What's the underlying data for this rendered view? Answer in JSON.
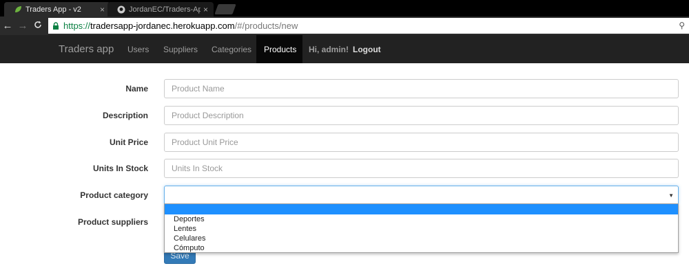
{
  "browser": {
    "tabs": [
      {
        "title": "Traders App - v2",
        "close": "×"
      },
      {
        "title": "JordanEC/Traders-App",
        "close": "×"
      }
    ],
    "nav": {
      "back": "←",
      "forward": "→",
      "reload": "C"
    },
    "url": {
      "scheme": "https://",
      "host": "tradersapp-jordanec.herokuapp.com",
      "path": "/#/products/new"
    },
    "key_glyph": "⚲"
  },
  "navbar": {
    "brand": "Traders app",
    "items": [
      "Users",
      "Suppliers",
      "Categories",
      "Products"
    ],
    "active": "Products",
    "greeting": "Hi, admin!",
    "logout": "Logout"
  },
  "form": {
    "name": {
      "label": "Name",
      "placeholder": "Product Name"
    },
    "description": {
      "label": "Description",
      "placeholder": "Product Description"
    },
    "unit_price": {
      "label": "Unit Price",
      "placeholder": "Product Unit Price"
    },
    "units_in_stock": {
      "label": "Units In Stock",
      "placeholder": "Units In Stock"
    },
    "category": {
      "label": "Product category",
      "value": "",
      "options": [
        "Deportes",
        "Lentes",
        "Celulares",
        "Cómputo"
      ]
    },
    "suppliers": {
      "label": "Product suppliers"
    },
    "save_label": "Save"
  },
  "colors": {
    "navbar_bg": "#222222",
    "active_tab_bg": "#080808",
    "primary": "#337ab7",
    "highlight": "#1e90ff"
  }
}
